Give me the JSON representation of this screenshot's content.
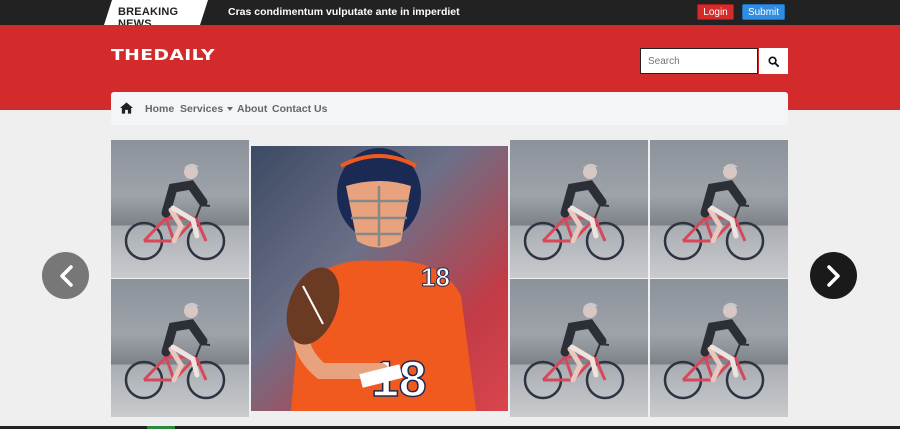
{
  "topbar": {
    "breaking_label": "BREAKING NEWS",
    "ticker_text": "Cras condimentum vulputate ante in imperdiet",
    "login_label": "Login",
    "submit_label": "Submit"
  },
  "header": {
    "logo_text": "THEDAILY",
    "search_placeholder": "Search"
  },
  "nav": {
    "items": [
      {
        "label": "Home"
      },
      {
        "label": "Services"
      },
      {
        "label": "About"
      },
      {
        "label": "Contact Us"
      }
    ]
  },
  "gallery": {
    "tiles": [
      {
        "icon": "cyclist-photo"
      },
      {
        "icon": "cyclist-photo"
      },
      {
        "icon": "football-player-photo"
      },
      {
        "icon": "cyclist-photo"
      },
      {
        "icon": "cyclist-photo"
      },
      {
        "icon": "cyclist-photo"
      },
      {
        "icon": "cyclist-photo"
      }
    ]
  },
  "colors": {
    "brand_red": "#d32b2b",
    "topbar_dark": "#222222",
    "login_red": "#d62b2b",
    "submit_blue": "#2f8ee0"
  }
}
